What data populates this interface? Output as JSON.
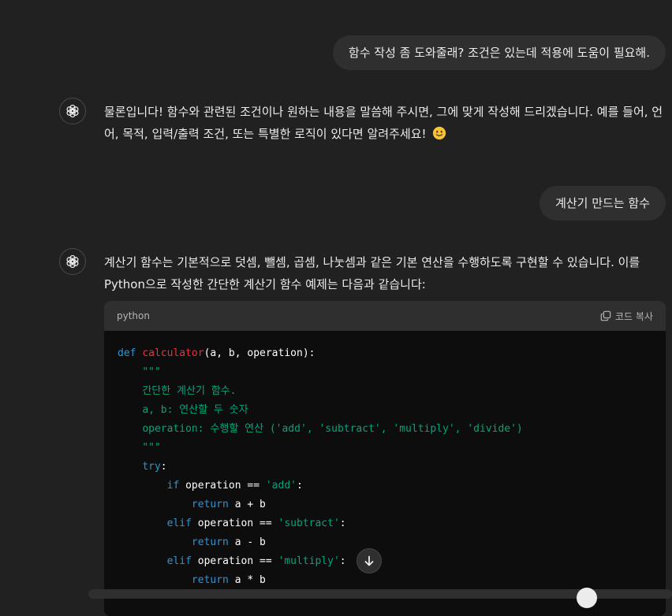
{
  "messages": {
    "user_1": "함수 작성 좀 도와줄래? 조건은 있는데 적용에 도움이 필요해.",
    "assistant_1": "물론입니다! 함수와 관련된 조건이나 원하는 내용을 말씀해 주시면, 그에 맞게 작성해 드리겠습니다. 예를 들어, 언어, 목적, 입력/출력 조건, 또는 특별한 로직이 있다면 알려주세요!",
    "user_2": "계산기 만드는 함수",
    "assistant_2": "계산기 함수는 기본적으로 덧셈, 뺄셈, 곱셈, 나눗셈과 같은 기본 연산을 수행하도록 구현할 수 있습니다. 이를 Python으로 작성한 간단한 계산기 함수 예제는 다음과 같습니다:"
  },
  "code_block": {
    "language": "python",
    "copy_label": "코드 복사",
    "lines": [
      [
        {
          "t": "def",
          "c": "kw"
        },
        {
          "t": " "
        },
        {
          "t": "calculator",
          "c": "fn"
        },
        {
          "t": "(a, b, operation):"
        }
      ],
      [
        {
          "t": "    "
        },
        {
          "t": "\"\"\"",
          "c": "str"
        }
      ],
      [
        {
          "t": "    "
        },
        {
          "t": "간단한 계산기 함수.",
          "c": "str"
        }
      ],
      [
        {
          "t": "    "
        },
        {
          "t": "a, b: 연산할 두 숫자",
          "c": "str"
        }
      ],
      [
        {
          "t": "    "
        },
        {
          "t": "operation: 수행할 연산 ('add', 'subtract', 'multiply', 'divide')",
          "c": "str"
        }
      ],
      [
        {
          "t": "    "
        },
        {
          "t": "\"\"\"",
          "c": "str"
        }
      ],
      [
        {
          "t": "    "
        },
        {
          "t": "try",
          "c": "kw"
        },
        {
          "t": ":"
        }
      ],
      [
        {
          "t": "        "
        },
        {
          "t": "if",
          "c": "kw"
        },
        {
          "t": " operation == "
        },
        {
          "t": "'add'",
          "c": "str"
        },
        {
          "t": ":"
        }
      ],
      [
        {
          "t": "            "
        },
        {
          "t": "return",
          "c": "kw"
        },
        {
          "t": " a + b"
        }
      ],
      [
        {
          "t": "        "
        },
        {
          "t": "elif",
          "c": "kw"
        },
        {
          "t": " operation == "
        },
        {
          "t": "'subtract'",
          "c": "str"
        },
        {
          "t": ":"
        }
      ],
      [
        {
          "t": "            "
        },
        {
          "t": "return",
          "c": "kw"
        },
        {
          "t": " a - b"
        }
      ],
      [
        {
          "t": "        "
        },
        {
          "t": "elif",
          "c": "kw"
        },
        {
          "t": " operation == "
        },
        {
          "t": "'multiply'",
          "c": "str"
        },
        {
          "t": ":"
        }
      ],
      [
        {
          "t": "            "
        },
        {
          "t": "return",
          "c": "kw"
        },
        {
          "t": " a * b"
        }
      ]
    ]
  },
  "icons": {
    "assistant_avatar": "openai-logo-icon",
    "emoji": "smiling-face-icon",
    "copy": "copy-icon",
    "scroll_down": "arrow-down-icon"
  },
  "colors": {
    "background": "#212121",
    "user_bubble": "#2f2f2f",
    "code_bg": "#0d0d0d",
    "keyword": "#2e95d3",
    "function": "#f22c3d",
    "string": "#00a67d"
  }
}
